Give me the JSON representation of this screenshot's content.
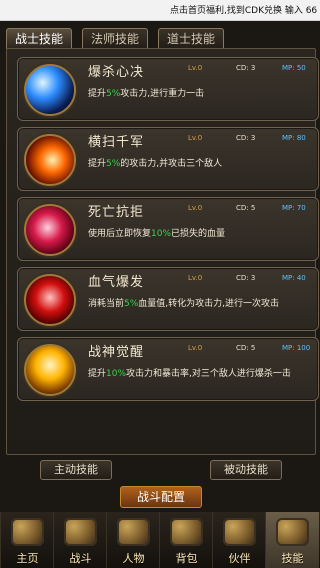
{
  "status": {
    "marquee": "点击首页福利,找到CDK兑换  输入 66"
  },
  "tabs": [
    {
      "label": "战士技能"
    },
    {
      "label": "法师技能"
    },
    {
      "label": "道士技能"
    }
  ],
  "skills": [
    {
      "name": "爆杀心决",
      "lv": "Lv.0",
      "cd": "CD: 3",
      "mp": "MP: 50",
      "desc_prefix": "提升",
      "desc_pct": "5%",
      "desc_suffix": "攻击力,进行重力一击"
    },
    {
      "name": "横扫千军",
      "lv": "Lv.0",
      "cd": "CD: 3",
      "mp": "MP: 80",
      "desc_prefix": "提升",
      "desc_pct": "5%",
      "desc_suffix": "的攻击力,并攻击三个敌人"
    },
    {
      "name": "死亡抗拒",
      "lv": "Lv.0",
      "cd": "CD: 5",
      "mp": "MP: 70",
      "desc_prefix": "使用后立即恢复",
      "desc_pct": "10%",
      "desc_suffix": "已损失的血量"
    },
    {
      "name": "血气爆发",
      "lv": "Lv.0",
      "cd": "CD: 3",
      "mp": "MP: 40",
      "desc_prefix": "消耗当前",
      "desc_pct": "5%",
      "desc_suffix": "血量值,转化为攻击力,进行一次攻击"
    },
    {
      "name": "战神觉醒",
      "lv": "Lv.0",
      "cd": "CD: 5",
      "mp": "MP: 100",
      "desc_prefix": "提升",
      "desc_pct": "10%",
      "desc_suffix": "攻击力和暴击率,对三个敌人进行爆杀一击"
    }
  ],
  "buttons": {
    "active_skills": "主动技能",
    "passive_skills": "被动技能",
    "battle_config": "战斗配置"
  },
  "nav": [
    {
      "label": "主页",
      "icon": "palace-icon"
    },
    {
      "label": "战斗",
      "icon": "crossed-swords-icon"
    },
    {
      "label": "人物",
      "icon": "armor-icon"
    },
    {
      "label": "背包",
      "icon": "chest-icon"
    },
    {
      "label": "伙伴",
      "icon": "handshake-icon"
    },
    {
      "label": "技能",
      "icon": "skill-book-icon"
    }
  ],
  "colors": {
    "accent_gold": "#d6a14b",
    "mp_blue": "#5cc3ff",
    "percent_green": "#38d44d"
  }
}
